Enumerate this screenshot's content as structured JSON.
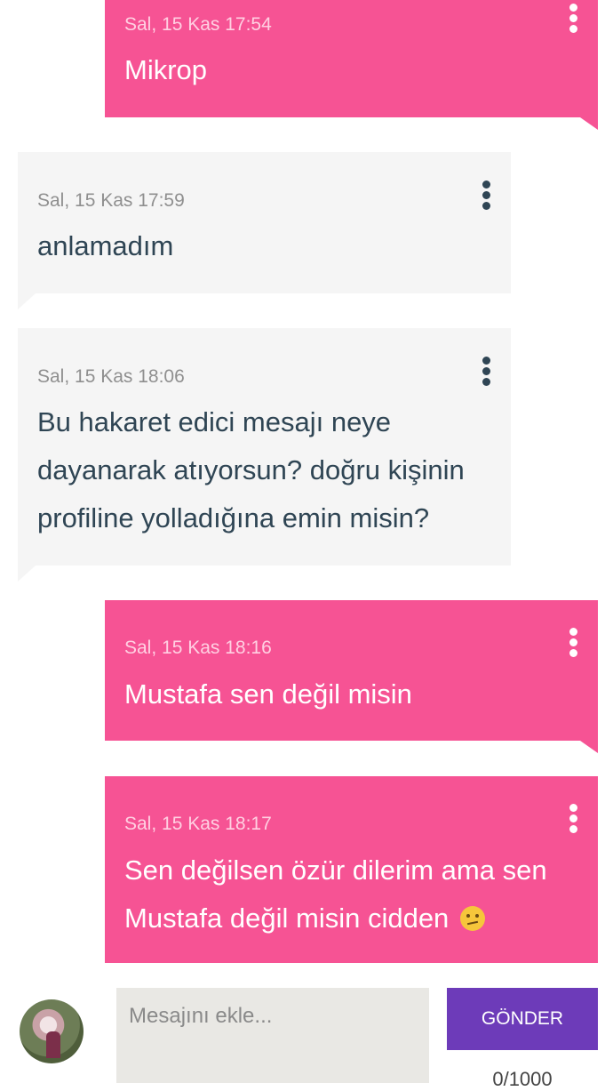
{
  "messages": [
    {
      "direction": "sent",
      "timestamp": "Sal, 15 Kas 17:54",
      "text": [
        "Mikrop"
      ]
    },
    {
      "direction": "received",
      "timestamp": "Sal, 15 Kas 17:59",
      "text": [
        "anlamadım"
      ]
    },
    {
      "direction": "received",
      "timestamp": "Sal, 15 Kas 18:06",
      "text": [
        "Bu hakaret edici mesajı neye",
        "dayanarak atıyorsun? doğru kişinin",
        "profiline yolladığına emin misin?"
      ]
    },
    {
      "direction": "sent",
      "timestamp": "Sal, 15 Kas 18:16",
      "text": [
        "Mustafa sen değil misin"
      ]
    },
    {
      "direction": "sent",
      "timestamp": "Sal, 15 Kas 18:17",
      "text": [
        "Sen değilsen özür dilerim ama sen",
        "Mustafa değil misin cidden"
      ],
      "emoji": "confused-face-emoji"
    }
  ],
  "composer": {
    "placeholder": "Mesajını ekle...",
    "send_label": "GÖNDER",
    "counter": "0/1000"
  },
  "colors": {
    "sent_bubble": "#f65394",
    "received_bubble": "#f5f5f5",
    "send_button": "#6d3bb9"
  },
  "icons": {
    "message_menu": "more-vertical-icon",
    "avatar": "user-avatar"
  }
}
